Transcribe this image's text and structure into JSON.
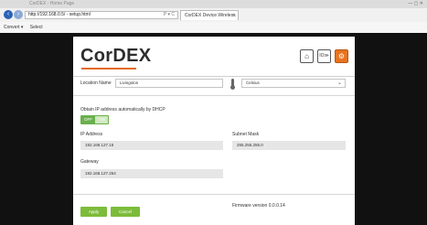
{
  "browser": {
    "title": "CorDEX - Home Page",
    "window_controls": "— ▢ ✕",
    "address": "http://192.168.0.5/ - setup.html",
    "address_controls": "P ▾ C",
    "tab_label": "CorDEX Device Wireless",
    "tab_close": "×",
    "back_icon": "‹",
    "forward_icon": "›",
    "favorites": [
      "Convert ▾",
      "Select"
    ]
  },
  "app": {
    "logo": "CorDEX",
    "home_icon": "⌂",
    "device_icon": "IO≫",
    "settings_icon": "⚙",
    "location": {
      "label": "Location Name",
      "value": "Livingston"
    },
    "temperature": {
      "selected": "Celsius",
      "chevron": "⌄"
    },
    "dhcp": {
      "label": "Obtain IP address automatically by DHCP",
      "off_label": "OFF",
      "on_label": "ON",
      "state": "off"
    },
    "ip_address": {
      "label": "IP Address",
      "value": "192.168.127.15"
    },
    "subnet_mask": {
      "label": "Subnet Mask",
      "value": "255.255.255.0"
    },
    "gateway": {
      "label": "Gateway",
      "value": "192.168.127.254"
    },
    "apply_label": "Apply",
    "cancel_label": "Cancel",
    "firmware": "Firmware version 0.0.0.14"
  },
  "colors": {
    "accent": "#e8731f",
    "button_green": "#7cbc3a",
    "toggle_green": "#6ab04c"
  }
}
